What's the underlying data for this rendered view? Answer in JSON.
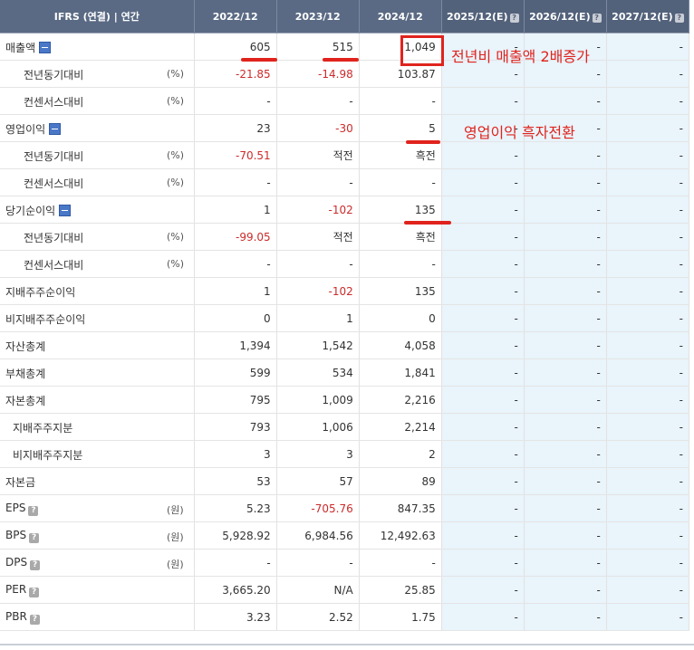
{
  "header": {
    "first_col": "IFRS (연결) | 연간",
    "years": [
      "2022/12",
      "2023/12",
      "2024/12"
    ],
    "estimates": [
      "2025/12(E)",
      "2026/12(E)",
      "2027/12(E)"
    ],
    "estimate_icon": "question-icon"
  },
  "rows": [
    {
      "label": "매출액",
      "level": 0,
      "toggle": true,
      "unit": "",
      "help": false,
      "values": [
        "605",
        "515",
        "1,049"
      ],
      "neg": [
        false,
        false,
        false
      ],
      "est": [
        "-",
        "-",
        "-"
      ]
    },
    {
      "label": "전년동기대비",
      "level": 1,
      "toggle": false,
      "unit": "(%)",
      "help": false,
      "values": [
        "-21.85",
        "-14.98",
        "103.87"
      ],
      "neg": [
        true,
        true,
        false
      ],
      "est": [
        "-",
        "-",
        "-"
      ]
    },
    {
      "label": "컨센서스대비",
      "level": 1,
      "toggle": false,
      "unit": "(%)",
      "help": false,
      "values": [
        "-",
        "-",
        "-"
      ],
      "neg": [
        false,
        false,
        false
      ],
      "est": [
        "-",
        "-",
        "-"
      ]
    },
    {
      "label": "영업이익",
      "level": 0,
      "toggle": true,
      "unit": "",
      "help": false,
      "values": [
        "23",
        "-30",
        "5"
      ],
      "neg": [
        false,
        true,
        false
      ],
      "est": [
        "-",
        "-",
        "-"
      ]
    },
    {
      "label": "전년동기대비",
      "level": 1,
      "toggle": false,
      "unit": "(%)",
      "help": false,
      "values": [
        "-70.51",
        "적전",
        "흑전"
      ],
      "neg": [
        true,
        false,
        false
      ],
      "est": [
        "-",
        "-",
        "-"
      ]
    },
    {
      "label": "컨센서스대비",
      "level": 1,
      "toggle": false,
      "unit": "(%)",
      "help": false,
      "values": [
        "-",
        "-",
        "-"
      ],
      "neg": [
        false,
        false,
        false
      ],
      "est": [
        "-",
        "-",
        "-"
      ]
    },
    {
      "label": "당기순이익",
      "level": 0,
      "toggle": true,
      "unit": "",
      "help": false,
      "values": [
        "1",
        "-102",
        "135"
      ],
      "neg": [
        false,
        true,
        false
      ],
      "est": [
        "-",
        "-",
        "-"
      ]
    },
    {
      "label": "전년동기대비",
      "level": 1,
      "toggle": false,
      "unit": "(%)",
      "help": false,
      "values": [
        "-99.05",
        "적전",
        "흑전"
      ],
      "neg": [
        true,
        false,
        false
      ],
      "est": [
        "-",
        "-",
        "-"
      ]
    },
    {
      "label": "컨센서스대비",
      "level": 1,
      "toggle": false,
      "unit": "(%)",
      "help": false,
      "values": [
        "-",
        "-",
        "-"
      ],
      "neg": [
        false,
        false,
        false
      ],
      "est": [
        "-",
        "-",
        "-"
      ]
    },
    {
      "label": "지배주주순이익",
      "level": 0,
      "toggle": false,
      "unit": "",
      "help": false,
      "values": [
        "1",
        "-102",
        "135"
      ],
      "neg": [
        false,
        true,
        false
      ],
      "est": [
        "-",
        "-",
        "-"
      ]
    },
    {
      "label": "비지배주주순이익",
      "level": 0,
      "toggle": false,
      "unit": "",
      "help": false,
      "values": [
        "0",
        "1",
        "0"
      ],
      "neg": [
        false,
        false,
        false
      ],
      "est": [
        "-",
        "-",
        "-"
      ]
    },
    {
      "label": "자산총계",
      "level": 0,
      "toggle": false,
      "unit": "",
      "help": false,
      "values": [
        "1,394",
        "1,542",
        "4,058"
      ],
      "neg": [
        false,
        false,
        false
      ],
      "est": [
        "-",
        "-",
        "-"
      ]
    },
    {
      "label": "부채총계",
      "level": 0,
      "toggle": false,
      "unit": "",
      "help": false,
      "values": [
        "599",
        "534",
        "1,841"
      ],
      "neg": [
        false,
        false,
        false
      ],
      "est": [
        "-",
        "-",
        "-"
      ]
    },
    {
      "label": "자본총계",
      "level": 0,
      "toggle": false,
      "unit": "",
      "help": false,
      "values": [
        "795",
        "1,009",
        "2,216"
      ],
      "neg": [
        false,
        false,
        false
      ],
      "est": [
        "-",
        "-",
        "-"
      ]
    },
    {
      "label": "지배주주지분",
      "level": 2,
      "toggle": false,
      "unit": "",
      "help": false,
      "values": [
        "793",
        "1,006",
        "2,214"
      ],
      "neg": [
        false,
        false,
        false
      ],
      "est": [
        "-",
        "-",
        "-"
      ]
    },
    {
      "label": "비지배주주지분",
      "level": 2,
      "toggle": false,
      "unit": "",
      "help": false,
      "values": [
        "3",
        "3",
        "2"
      ],
      "neg": [
        false,
        false,
        false
      ],
      "est": [
        "-",
        "-",
        "-"
      ]
    },
    {
      "label": "자본금",
      "level": 0,
      "toggle": false,
      "unit": "",
      "help": false,
      "values": [
        "53",
        "57",
        "89"
      ],
      "neg": [
        false,
        false,
        false
      ],
      "est": [
        "-",
        "-",
        "-"
      ]
    },
    {
      "label": "EPS",
      "level": 0,
      "toggle": false,
      "unit": "(원)",
      "help": true,
      "values": [
        "5.23",
        "-705.76",
        "847.35"
      ],
      "neg": [
        false,
        true,
        false
      ],
      "est": [
        "-",
        "-",
        "-"
      ]
    },
    {
      "label": "BPS",
      "level": 0,
      "toggle": false,
      "unit": "(원)",
      "help": true,
      "values": [
        "5,928.92",
        "6,984.56",
        "12,492.63"
      ],
      "neg": [
        false,
        false,
        false
      ],
      "est": [
        "-",
        "-",
        "-"
      ]
    },
    {
      "label": "DPS",
      "level": 0,
      "toggle": false,
      "unit": "(원)",
      "help": true,
      "values": [
        "-",
        "-",
        "-"
      ],
      "neg": [
        false,
        false,
        false
      ],
      "est": [
        "-",
        "-",
        "-"
      ]
    },
    {
      "label": "PER",
      "level": 0,
      "toggle": false,
      "unit": "",
      "help": true,
      "values": [
        "3,665.20",
        "N/A",
        "25.85"
      ],
      "neg": [
        false,
        false,
        false
      ],
      "est": [
        "-",
        "-",
        "-"
      ]
    },
    {
      "label": "PBR",
      "level": 0,
      "toggle": false,
      "unit": "",
      "help": true,
      "values": [
        "3.23",
        "2.52",
        "1.75"
      ],
      "neg": [
        false,
        false,
        false
      ],
      "est": [
        "-",
        "-",
        "-"
      ]
    }
  ],
  "annotations": {
    "revenue_note": "전년비 매출액 2배증가",
    "op_income_note": "영업이익 흑자전환",
    "color": "#e0231d"
  },
  "colors": {
    "header_bg": "#5a6a84",
    "estimate_bg": "#e9f4fb",
    "negative": "#cc2b2b",
    "toggle": "#4a78c7"
  }
}
